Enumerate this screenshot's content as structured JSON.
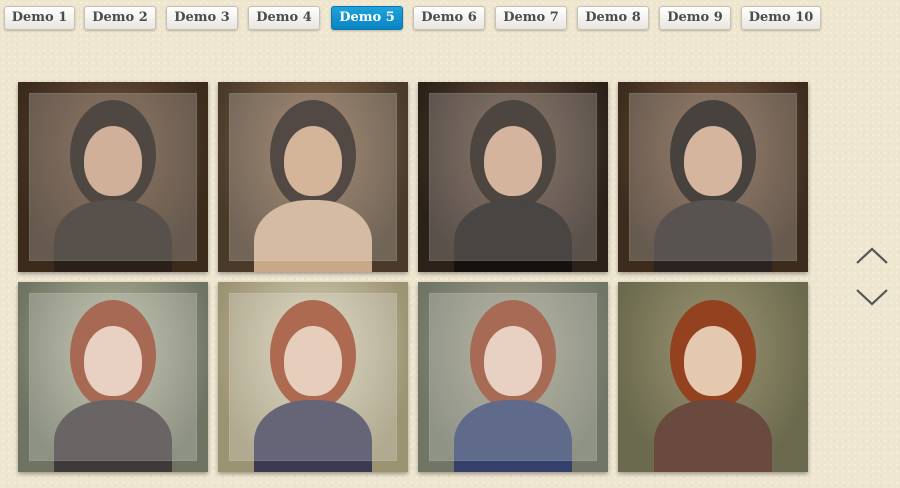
{
  "nav": {
    "items": [
      {
        "label": "Demo 1",
        "active": false
      },
      {
        "label": "Demo 2",
        "active": false
      },
      {
        "label": "Demo 3",
        "active": false
      },
      {
        "label": "Demo 4",
        "active": false
      },
      {
        "label": "Demo 5",
        "active": true
      },
      {
        "label": "Demo 6",
        "active": false
      },
      {
        "label": "Demo 7",
        "active": false
      },
      {
        "label": "Demo 8",
        "active": false
      },
      {
        "label": "Demo 9",
        "active": false
      },
      {
        "label": "Demo 10",
        "active": false
      }
    ]
  },
  "gallery": {
    "tiles": [
      {
        "bg": "#3b2b1d",
        "bg2": "#6e5039",
        "hair": "#1e140d",
        "skin": "#c49a7e",
        "body": "#2a2019",
        "frame": true
      },
      {
        "bg": "#4a3a2a",
        "bg2": "#8c6d4d",
        "hair": "#221710",
        "skin": "#c9a07d",
        "body": "#c9a88a",
        "frame": true
      },
      {
        "bg": "#2c2119",
        "bg2": "#6b5140",
        "hair": "#1a110b",
        "skin": "#c99f82",
        "body": "#15110f",
        "frame": true
      },
      {
        "bg": "#3d2c1e",
        "bg2": "#7b5c43",
        "hair": "#140d08",
        "skin": "#caa083",
        "body": "#2a2320",
        "frame": true
      },
      {
        "bg": "#6f7462",
        "bg2": "#b5b59c",
        "hair": "#8f3f24",
        "skin": "#e2c3b1",
        "body": "#3f3a3a",
        "frame": true
      },
      {
        "bg": "#9c9373",
        "bg2": "#d6cfb4",
        "hair": "#97401f",
        "skin": "#e0c1a9",
        "body": "#3c3a52",
        "frame": true
      },
      {
        "bg": "#707565",
        "bg2": "#a3a08a",
        "hair": "#8e4026",
        "skin": "#e2c5b3",
        "body": "#34406a",
        "frame": true
      },
      {
        "bg": "#6b6a4e",
        "bg2": "#9c9472",
        "hair": "#93411f",
        "skin": "#e5c8b0",
        "body": "#6a4a3f",
        "frame": false
      }
    ]
  },
  "scroll": {
    "up_icon": "chevron-up-icon",
    "down_icon": "chevron-down-icon",
    "color": "#555555"
  }
}
